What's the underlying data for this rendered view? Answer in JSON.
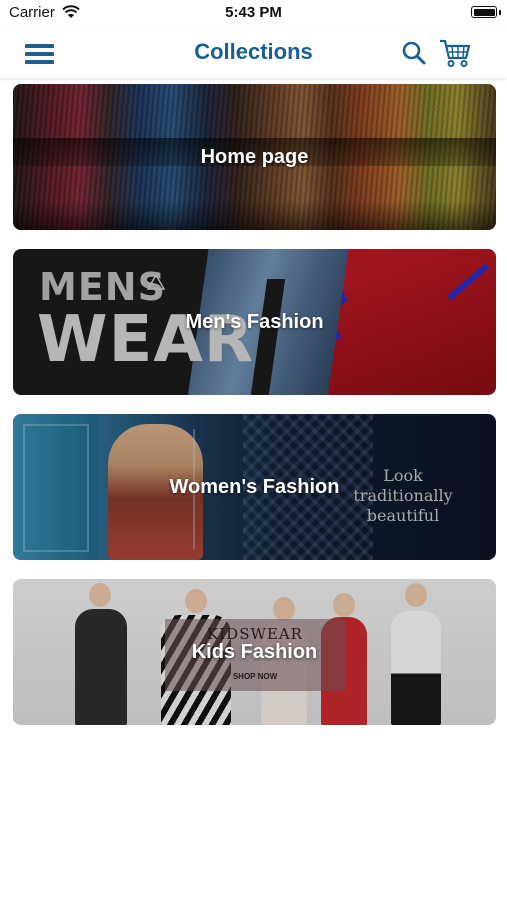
{
  "status_bar": {
    "carrier": "Carrier",
    "time": "5:43 PM"
  },
  "nav": {
    "title": "Collections"
  },
  "collections": [
    {
      "title": "Home page"
    },
    {
      "title": "Men's Fashion",
      "image_text": [
        "MENS",
        "WEAR"
      ]
    },
    {
      "title": "Women's Fashion",
      "image_text": [
        "Look traditionally",
        "beautiful"
      ]
    },
    {
      "title": "Kids Fashion",
      "image_text": [
        "KIDSWEAR",
        "SHOP NOW"
      ]
    }
  ],
  "colors": {
    "accent": "#1a5f92",
    "background": "#ffffff"
  },
  "icons": [
    "menu-icon",
    "search-icon",
    "cart-icon",
    "wifi-icon",
    "battery-icon"
  ]
}
